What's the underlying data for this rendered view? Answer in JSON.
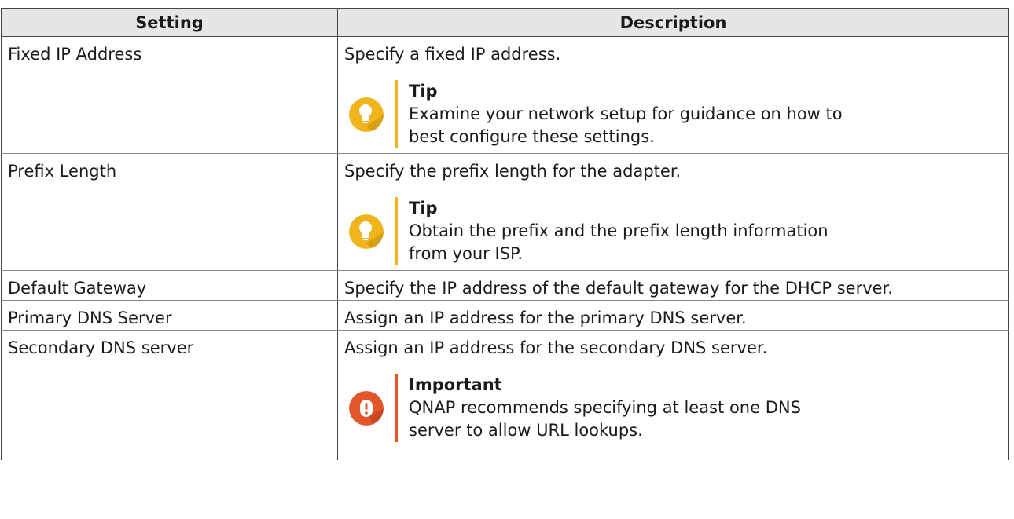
{
  "table": {
    "headers": [
      "Setting",
      "Description"
    ],
    "rows": [
      {
        "setting": "Fixed IP Address",
        "description": "Specify a fixed IP address.",
        "note": {
          "type": "tip",
          "title": "Tip",
          "text": "Examine your network setup for guidance on how to best configure these settings."
        }
      },
      {
        "setting": "Prefix Length",
        "description": "Specify the prefix length for the adapter.",
        "note": {
          "type": "tip",
          "title": "Tip",
          "text": "Obtain the prefix and the prefix length information from your ISP."
        }
      },
      {
        "setting": "Default Gateway",
        "description": "Specify the IP address of the default gateway for the DHCP server."
      },
      {
        "setting": "Primary DNS Server",
        "description": "Assign an IP address for the primary DNS server."
      },
      {
        "setting": "Secondary DNS server",
        "description": "Assign an IP address for the secondary DNS server.",
        "note": {
          "type": "important",
          "title": "Important",
          "text": "QNAP recommends specifying at least one DNS server to allow URL lookups."
        }
      }
    ]
  },
  "colors": {
    "tip": "#f0b41c",
    "important": "#e2562a",
    "header_bg": "#e6e6e6"
  },
  "icons": {
    "tip": "lightbulb-icon",
    "important": "exclamation-icon"
  }
}
